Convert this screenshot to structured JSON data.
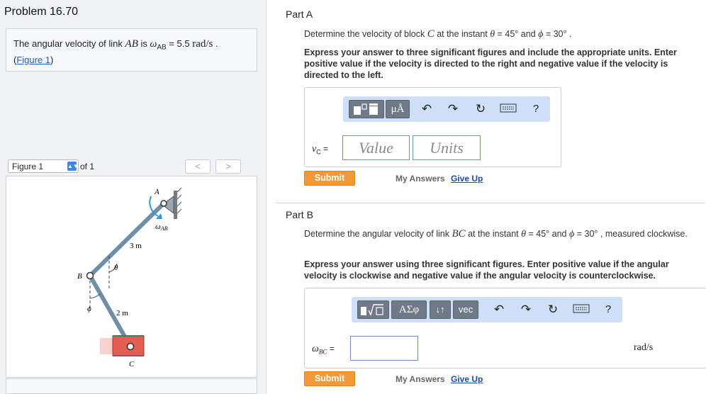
{
  "problem": {
    "title": "Problem 16.70",
    "statement": {
      "pre": "The angular velocity of link ",
      "link": "AB",
      "mid": " is ",
      "omega": "ω",
      "sub": "AB",
      "eq": " = 5.5 ",
      "unit": "rad/s",
      "end": " ."
    },
    "figure_link": "Figure 1"
  },
  "figure_nav": {
    "select_value": "Figure 1",
    "of_label": "of 1",
    "prev_label": "<",
    "next_label": ">"
  },
  "figure": {
    "label_A": "A",
    "label_B": "B",
    "label_C": "C",
    "omega_label": "ω",
    "omega_sub": "AB",
    "len_AB": "3 m",
    "len_BC": "2 m",
    "theta": "θ",
    "phi": "ϕ"
  },
  "part_a": {
    "title": "Part A",
    "question": {
      "pre": "Determine the velocity of block ",
      "var": "C",
      "mid": " at the instant ",
      "theta": "θ",
      "theta_val": " = 45° ",
      "and": " and ",
      "phi": "ϕ",
      "phi_val": " = 30° ."
    },
    "instructions": "Express your answer to three significant figures and include the appropriate units. Enter positive value if the velocity is directed to the right and negative value if the velocity is directed to the left.",
    "toolbar": {
      "units_btn": "μÅ",
      "help": "?"
    },
    "answer_label": {
      "v": "v",
      "sub": "C",
      "eq": " ="
    },
    "value_placeholder": "Value",
    "units_placeholder": "Units",
    "submit": "Submit",
    "my_answers": "My Answers",
    "give_up": "Give Up"
  },
  "part_b": {
    "title": "Part B",
    "question": {
      "pre": "Determine the angular velocity of link ",
      "var": "BC",
      "mid": " at the instant ",
      "theta": "θ",
      "theta_val": " = 45° ",
      "and": " and ",
      "phi": "ϕ",
      "phi_val": " = 30° , measured clockwise."
    },
    "instructions": "Express your answer using three significant figures. Enter positive value if the angular velocity is clockwise and negative value if the angular velocity is counterclockwise.",
    "toolbar": {
      "greek_btn": "ΑΣφ",
      "arrows_btn": "↓↑",
      "vec_btn": "vec",
      "help": "?"
    },
    "answer_label": {
      "w": "ω",
      "sub": "BC",
      "eq": " ="
    },
    "unit": "rad/s",
    "submit": "Submit",
    "my_answers": "My Answers",
    "give_up": "Give Up"
  },
  "colors": {
    "submit": "#f29a37",
    "toolbar": "#cde0f7",
    "link": "#2a5db0",
    "field_border": "#6d8ec2"
  }
}
